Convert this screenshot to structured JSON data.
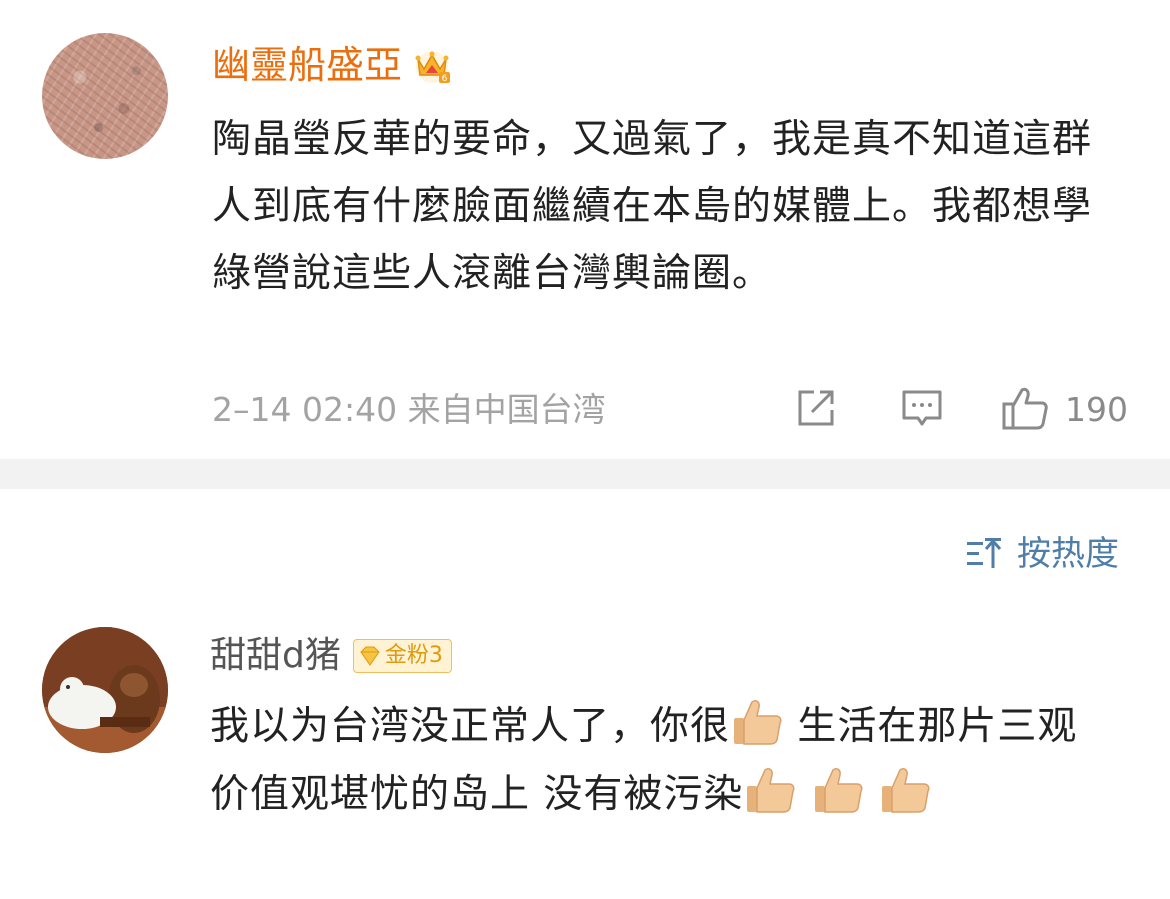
{
  "post1": {
    "username": "幽靈船盛亞",
    "body": "陶晶瑩反華的要命，又過氣了，我是真不知道這群人到底有什麼臉面繼續在本島的媒體上。我都想學綠營說這些人滾離台灣輿論圈。",
    "timestamp": "2–14 02:40 来自中国台湾",
    "like_count": "190",
    "icons": {
      "share": "share-icon",
      "comment": "comment-icon",
      "like": "like-icon",
      "vip": "crown-icon"
    },
    "name_color": "#eb6e0e"
  },
  "sort": {
    "label": "按热度"
  },
  "post2": {
    "username": "甜甜d猪",
    "badge": "金粉3",
    "body_line_a": "我以为台湾没正常人了，你很",
    "body_line_b": "  生活在那片三观价值观堪忧的岛上 没有被污染",
    "icons": {
      "emoji": "thumbs-up-emoji"
    }
  },
  "colors": {
    "accent_link": "#4f7ea8",
    "meta_gray": "#a3a3a3"
  }
}
